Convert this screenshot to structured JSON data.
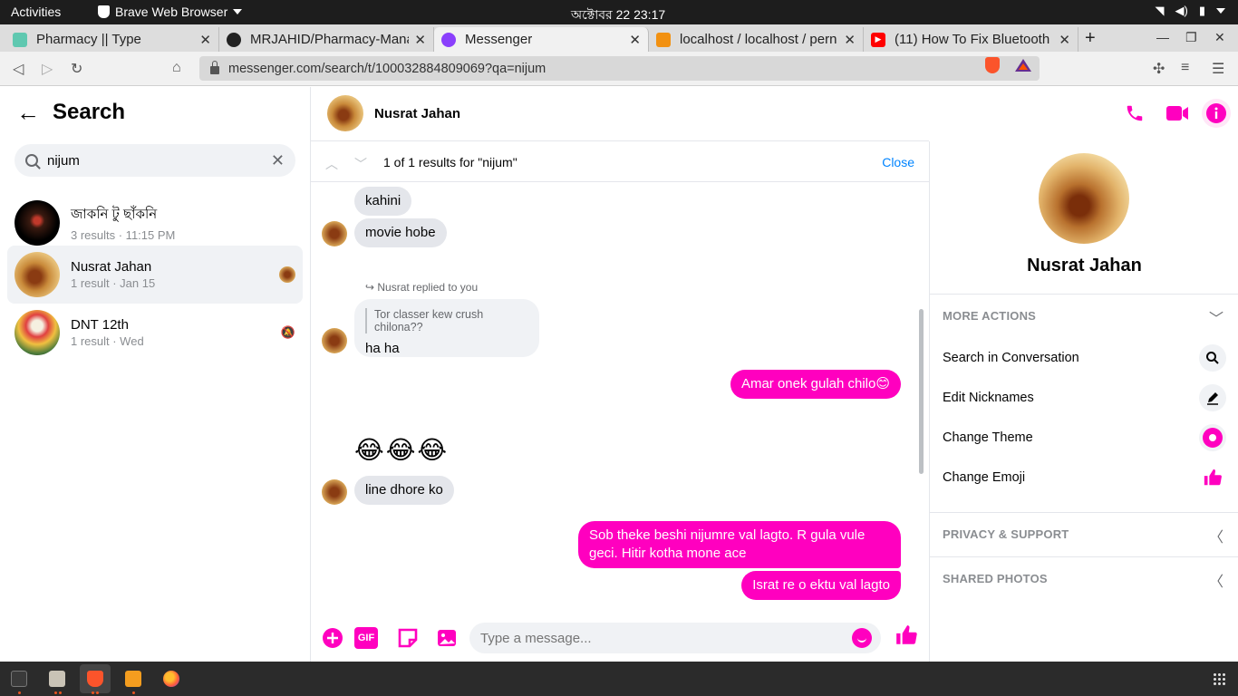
{
  "system_bar": {
    "activities": "Activities",
    "app_name": "Brave Web Browser",
    "clock": "অক্টোবর 22  23:17"
  },
  "tabs": [
    {
      "title": "Pharmacy || Type",
      "active": false
    },
    {
      "title": "MRJAHID/Pharmacy-Mana",
      "active": false
    },
    {
      "title": "Messenger",
      "active": true
    },
    {
      "title": "localhost / localhost / pern",
      "active": false
    },
    {
      "title": "(11) How To Fix Bluetooth",
      "active": false
    }
  ],
  "address_bar": {
    "url": "messenger.com/search/t/100032884809069?qa=nijum"
  },
  "left_panel": {
    "title": "Search",
    "search_value": "nijum",
    "results": [
      {
        "name": "জাকনি টু ছাঁকনি",
        "meta": "3 results · 11:15 PM"
      },
      {
        "name": "Nusrat Jahan",
        "meta": "1 result · Jan 15"
      },
      {
        "name": "DNT 12th",
        "meta": "1 result · Wed"
      }
    ]
  },
  "chat": {
    "contact_name": "Nusrat Jahan",
    "find_count": "1 of 1 results for \"nijum\"",
    "find_close": "Close",
    "peek_text": "Tor classer kew crush chilona??",
    "messages": {
      "m1": "kahini",
      "m2": "movie hobe",
      "reply_note": "Nusrat replied to you",
      "reply_quote": "Tor classer kew crush chilona??",
      "reply_text": "ha ha",
      "m3": "Amar onek gulah chilo😊",
      "m4": "😂😂😂",
      "m5": "line dhore ko",
      "m6_line1": "Sob theke beshi nijumre val lagto. R gula vule",
      "m6_line2": "geci. Hitir kotha mone ace",
      "m7": "Israt re o ektu val lagto"
    },
    "composer_placeholder": "Type a message...",
    "gif_label": "GIF"
  },
  "info_panel": {
    "name": "Nusrat Jahan",
    "more_actions": "MORE ACTIONS",
    "actions": [
      {
        "label": "Search in Conversation",
        "icon": "search-icon"
      },
      {
        "label": "Edit Nicknames",
        "icon": "pencil-icon"
      },
      {
        "label": "Change Theme",
        "icon": "theme-icon"
      },
      {
        "label": "Change Emoji",
        "icon": "thumbs-up-icon"
      }
    ],
    "privacy": "PRIVACY & SUPPORT",
    "shared_photos": "SHARED PHOTOS"
  },
  "colors": {
    "accent": "#ff00bf",
    "link": "#0084ff"
  }
}
